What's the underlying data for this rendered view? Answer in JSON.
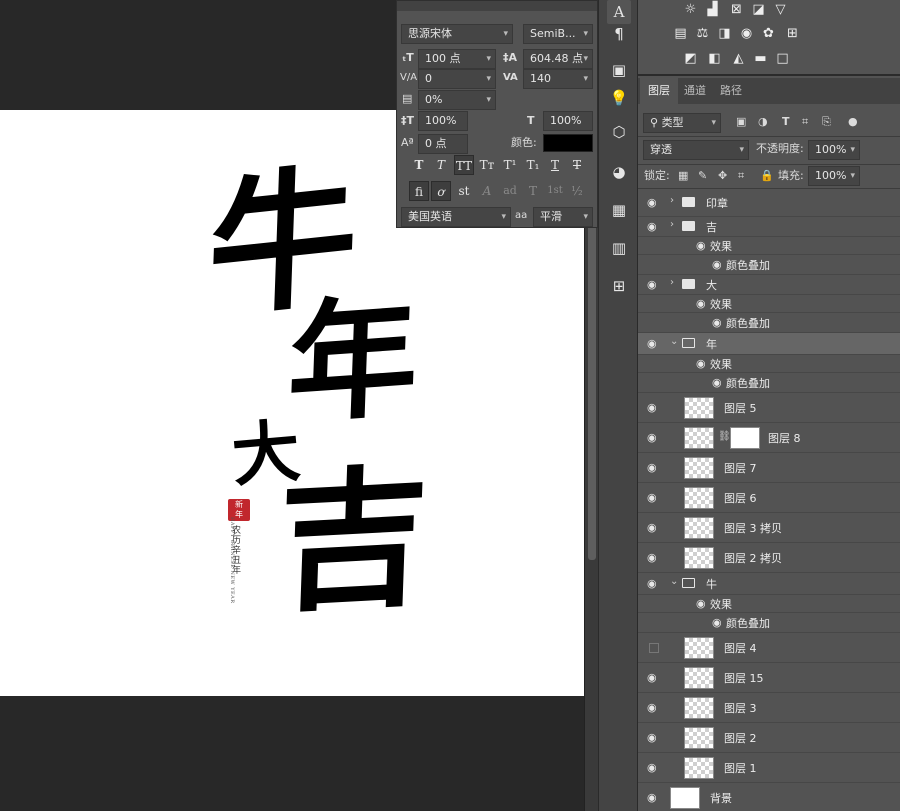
{
  "artwork": {
    "chars": [
      "牛",
      "年",
      "大",
      "吉"
    ],
    "seal_text": "新年",
    "sub_cn": "农历辛丑年",
    "sub_en": "HAPPY CHINESE NEW YEAR"
  },
  "char_panel": {
    "font_family": "思源宋体",
    "font_style": "SemiB...",
    "font_size": "100 点",
    "leading": "604.48 点",
    "kerning": "0",
    "tracking": "140",
    "tsume": "0%",
    "vscale": "100%",
    "hscale": "100%",
    "baseline": "0 点",
    "color_label": "颜色:",
    "language": "美国英语",
    "aa_label": "aa",
    "antialias": "平滑",
    "style_buttons": [
      "T",
      "T",
      "TT",
      "Tт",
      "T¹",
      "T₁",
      "T",
      "T"
    ],
    "ot_buttons": [
      "fi",
      "ơ",
      "st",
      "A",
      "ad",
      "T",
      "1st",
      "½"
    ]
  },
  "tabs": [
    "图层",
    "通道",
    "路径"
  ],
  "layer_controls": {
    "filter_kind": "类型",
    "blend_mode": "穿透",
    "opacity_label": "不透明度:",
    "opacity": "100%",
    "lock_label": "锁定:",
    "fill_label": "填充:",
    "fill": "100%"
  },
  "layers": [
    {
      "name": "印章"
    },
    {
      "name": "吉"
    },
    {
      "name": "效果"
    },
    {
      "name": "颜色叠加"
    },
    {
      "name": "大"
    },
    {
      "name": "效果"
    },
    {
      "name": "颜色叠加"
    },
    {
      "name": "年"
    },
    {
      "name": "效果"
    },
    {
      "name": "颜色叠加"
    },
    {
      "name": "图层 5"
    },
    {
      "name": "图层 8"
    },
    {
      "name": "图层 7"
    },
    {
      "name": "图层 6"
    },
    {
      "name": "图层 3 拷贝"
    },
    {
      "name": "图层 2 拷贝"
    },
    {
      "name": "牛"
    },
    {
      "name": "效果"
    },
    {
      "name": "颜色叠加"
    },
    {
      "name": "图层 4"
    },
    {
      "name": "图层 15"
    },
    {
      "name": "图层 3"
    },
    {
      "name": "图层 2"
    },
    {
      "name": "图层 1"
    },
    {
      "name": "背景"
    }
  ],
  "colors": {
    "selected_row": "#666666",
    "panel": "#535353",
    "canvas": "#ffffff"
  }
}
